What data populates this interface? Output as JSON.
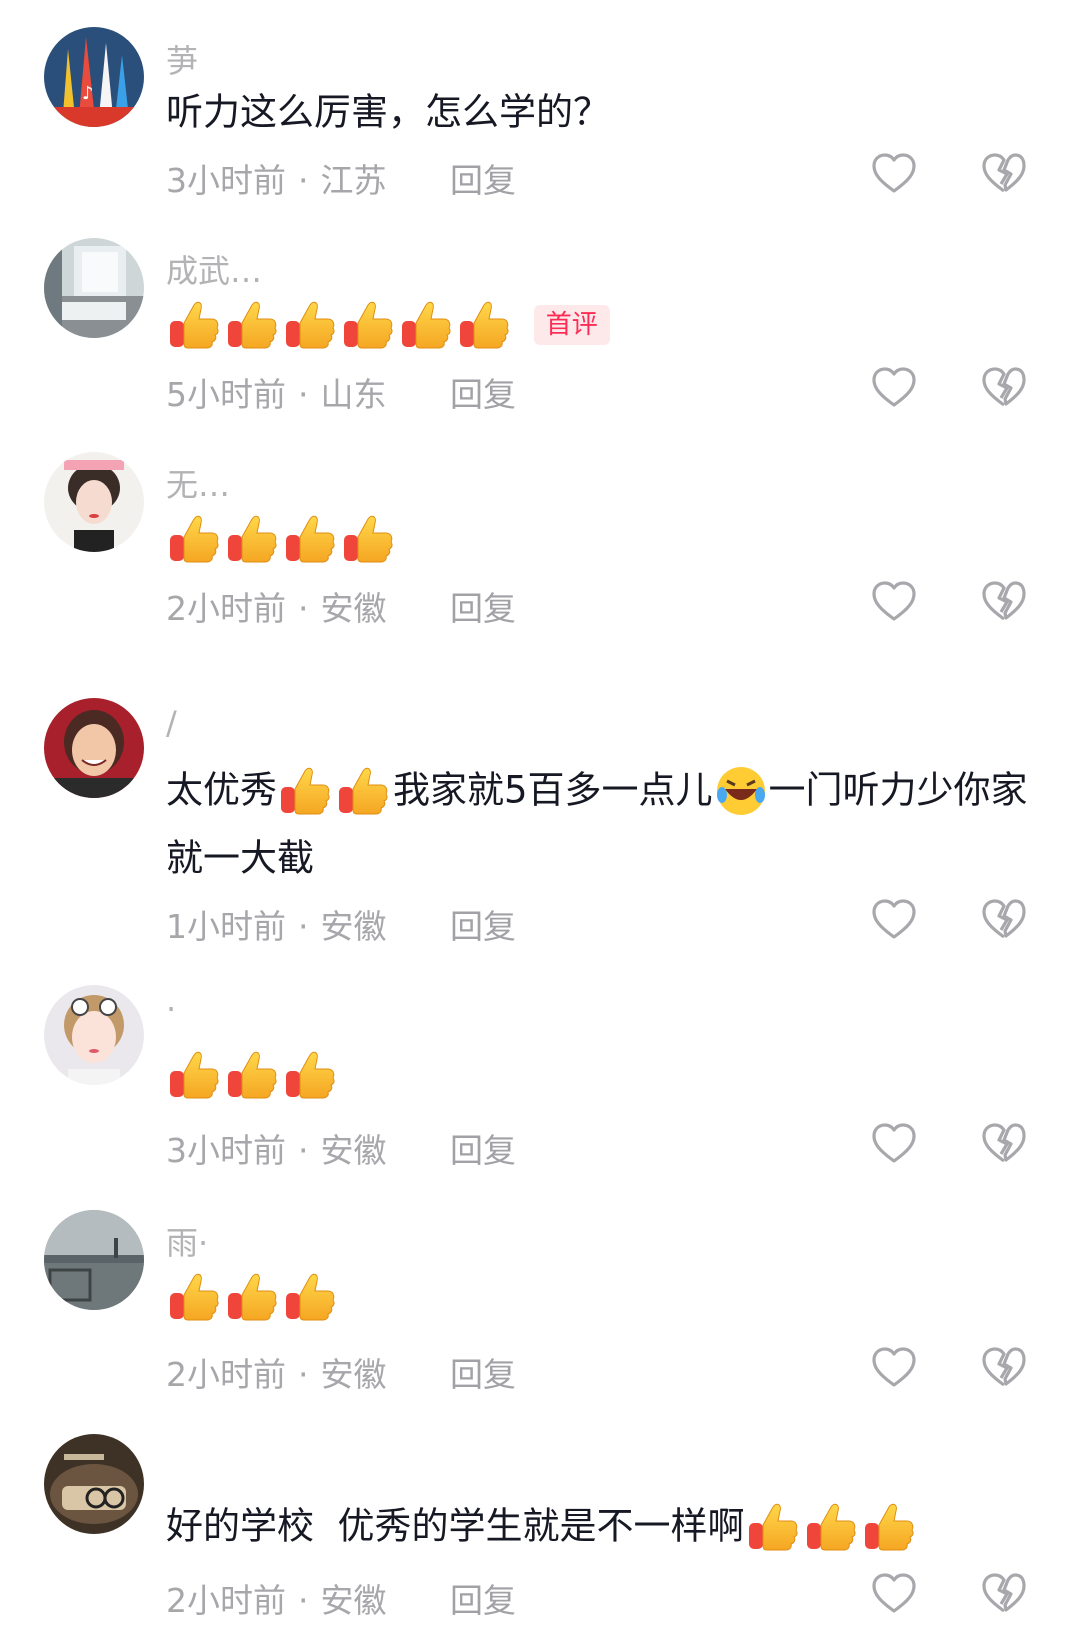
{
  "colors": {
    "meta_text": "#a7a7ab",
    "badge_text": "#fe2c55",
    "badge_bg": "#fde8ea",
    "icon_stroke": "#a8a8ac"
  },
  "icons": {
    "like": "heart-outline-icon",
    "dislike": "broken-heart-icon",
    "thumb": "thumbs-up-emoji",
    "laugh": "rolling-laughing-emoji"
  },
  "comments": [
    {
      "username": "芛",
      "text": "听力这么厉害，怎么学的？",
      "time": "3小时前",
      "sep": "·",
      "location": "江苏",
      "reply": "回复"
    },
    {
      "username": "成武…",
      "thumbs": 6,
      "badge": "首评",
      "time": "5小时前",
      "sep": "·",
      "location": "山东",
      "reply": "回复"
    },
    {
      "username": "无…",
      "thumbs": 4,
      "time": "2小时前",
      "sep": "·",
      "location": "安徽",
      "reply": "回复"
    },
    {
      "username": "/",
      "text_a": "太优秀",
      "text_b": "我家就5百多一点儿",
      "text_c": "一门听力少你家就一大截",
      "time": "1小时前",
      "sep": "·",
      "location": "安徽",
      "reply": "回复"
    },
    {
      "username": "·",
      "thumbs": 3,
      "time": "3小时前",
      "sep": "·",
      "location": "安徽",
      "reply": "回复"
    },
    {
      "username": "雨·",
      "thumbs": 3,
      "time": "2小时前",
      "sep": "·",
      "location": "安徽",
      "reply": "回复"
    },
    {
      "username": "",
      "text": "好的学校  优秀的学生就是不一样啊",
      "thumbs": 3,
      "time": "2小时前",
      "sep": "·",
      "location": "安徽",
      "reply": "回复"
    }
  ]
}
